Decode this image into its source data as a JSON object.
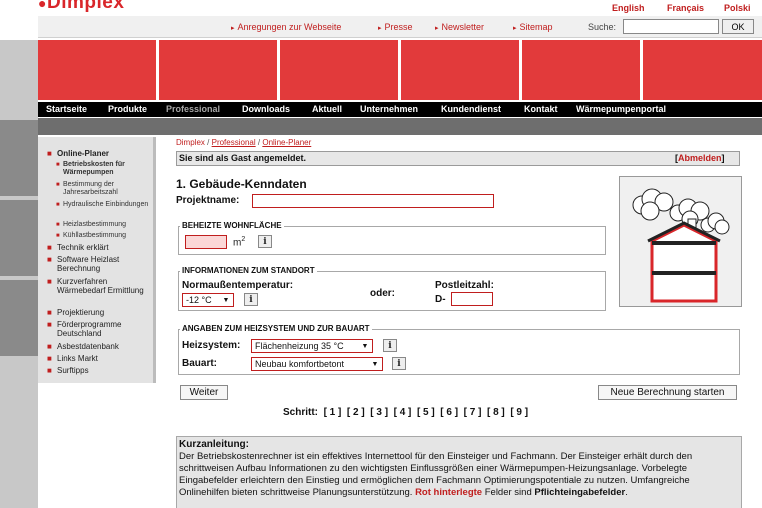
{
  "brand": {
    "logo": "Dimplex"
  },
  "languages": [
    "English",
    "Français",
    "Polski"
  ],
  "utility_links": [
    "Anregungen zur Webseite",
    "Presse",
    "Newsletter",
    "Sitemap"
  ],
  "search": {
    "label": "Suche:",
    "button": "OK",
    "value": ""
  },
  "nav": [
    "Startseite",
    "Produkte",
    "Professional",
    "Downloads",
    "Aktuell",
    "Unternehmen",
    "Kundendienst",
    "Kontakt",
    "Wärmepumpenportal"
  ],
  "sidebar": {
    "items": [
      {
        "label": "Online-Planer",
        "level": 1,
        "bold": true
      },
      {
        "label": "Betriebskosten für Wärmepumpen",
        "level": 2,
        "bold": true
      },
      {
        "label": "Bestimmung der Jahresarbeitszahl",
        "level": 2
      },
      {
        "label": "Hydraulische Einbindungen",
        "level": 2
      },
      {
        "label": "Heizlastbestimmung",
        "level": 2
      },
      {
        "label": "Kühllastbestimmung",
        "level": 2
      },
      {
        "label": "Technik erklärt",
        "level": 1
      },
      {
        "label": "Software Heizlast Berechnung",
        "level": 1
      },
      {
        "label": "Kurzverfahren Wärmebedarf Ermittlung",
        "level": 1
      },
      {
        "label": "Projektierung",
        "level": 1
      },
      {
        "label": "Förderprogramme Deutschland",
        "level": 1
      },
      {
        "label": "Asbestdatenbank",
        "level": 1
      },
      {
        "label": "Links Markt",
        "level": 1
      },
      {
        "label": "Surftipps",
        "level": 1
      }
    ]
  },
  "breadcrumb": [
    "Dimplex",
    "Professional",
    "Online-Planer"
  ],
  "breadcrumb_sep": "/",
  "guest": {
    "text": "Sie sind als Gast angemeldet.",
    "logout": "Abmelden",
    "bracket_open": "[",
    "bracket_close": "]"
  },
  "form": {
    "title": "1. Gebäude-Kenndaten",
    "projektname_label": "Projektname:",
    "projektname_value": "",
    "wohnflaeche_legend": "BEHEIZTE WOHNFLÄCHE",
    "wohnflaeche_unit": "m",
    "wohnflaeche_unit_exp": "2",
    "info_glyph": "i",
    "standort_legend": "INFORMATIONEN ZUM STANDORT",
    "normaussen_label": "Normaußentemperatur:",
    "normaussen_value": "-12 °C",
    "oder": "oder:",
    "plz_label": "Postleitzahl:",
    "plz_prefix": "D-",
    "heizsystem_legend": "ANGABEN ZUM HEIZSYSTEM UND ZUR BAUART",
    "heizsystem_label": "Heizsystem:",
    "heizsystem_value": "Flächenheizung 35 °C",
    "bauart_label": "Bauart:",
    "bauart_value": "Neubau komfortbetont",
    "caret": "▼"
  },
  "buttons": {
    "weiter": "Weiter",
    "neu": "Neue Berechnung starten"
  },
  "steps": {
    "label": "Schritt:",
    "items": [
      "[ 1 ]",
      "[ 2 ]",
      "[ 3 ]",
      "[ 4 ]",
      "[ 5 ]",
      "[ 6 ]",
      "[ 7 ]",
      "[ 8 ]",
      "[ 9 ]"
    ]
  },
  "kurzanleitung": {
    "title": "Kurzanleitung:",
    "text": "Der Betriebskostenrechner ist ein effektives Internettool für den Einsteiger und Fachmann. Der Einsteiger erhält durch den schrittweisen Aufbau Informationen zu den wichtigsten Einflussgrößen einer Wärmepumpen-Heizungsanlage. Vorbelegte Eingabefelder erleichtern den Einstieg und ermöglichen dem Fachmann Optimierungspotentiale zu nutzen. Umfangreiche Onlinehilfen bieten schrittweise Planungsunterstützung.",
    "red_part": "Rot hinterlegte",
    "after_red": "Felder sind",
    "bold_part": "Pflichteingabefelder",
    "end": "."
  },
  "colors": {
    "accent": "#c01e1e",
    "header_red": "#e23a3b",
    "nav_bg": "#000000"
  }
}
